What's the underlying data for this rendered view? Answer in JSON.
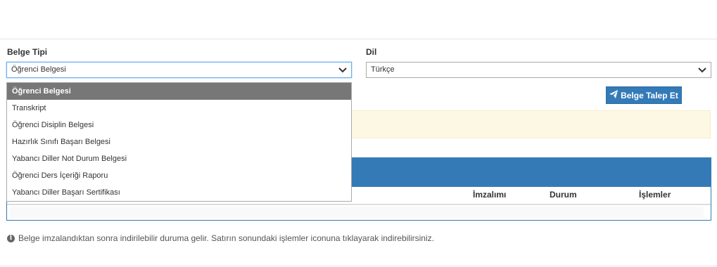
{
  "form": {
    "belge_tipi_label": "Belge Tipi",
    "belge_tipi_value": "Öğrenci Belgesi",
    "dil_label": "Dil",
    "dil_value": "Türkçe"
  },
  "dropdown": {
    "options": [
      "Öğrenci Belgesi",
      "Transkript",
      "Öğrenci Disiplin Belgesi",
      "Hazırlık Sınıfı Başarı Belgesi",
      "Yabancı Diller Not Durum Belgesi",
      "Öğrenci Ders İçeriği Raporu",
      "Yabancı Diller Başarı Sertifikası"
    ],
    "selected_index": 0
  },
  "actions": {
    "request_label": "Belge Talep Et",
    "request_icon": "paper-plane-icon"
  },
  "table": {
    "headers": {
      "imzalimi": "İmzalımı",
      "durum": "Durum",
      "islemler": "İşlemler"
    }
  },
  "info": {
    "icon": "info-circle-icon",
    "text": "Belge imzalandıktan sonra indirilebilir duruma gelir. Satırın sonundaki işlemler iconuna tıklayarak indirebilirsiniz."
  },
  "colors": {
    "primary": "#337ab7",
    "selected_option": "#777777",
    "alert_bg": "#fcf8e3"
  }
}
